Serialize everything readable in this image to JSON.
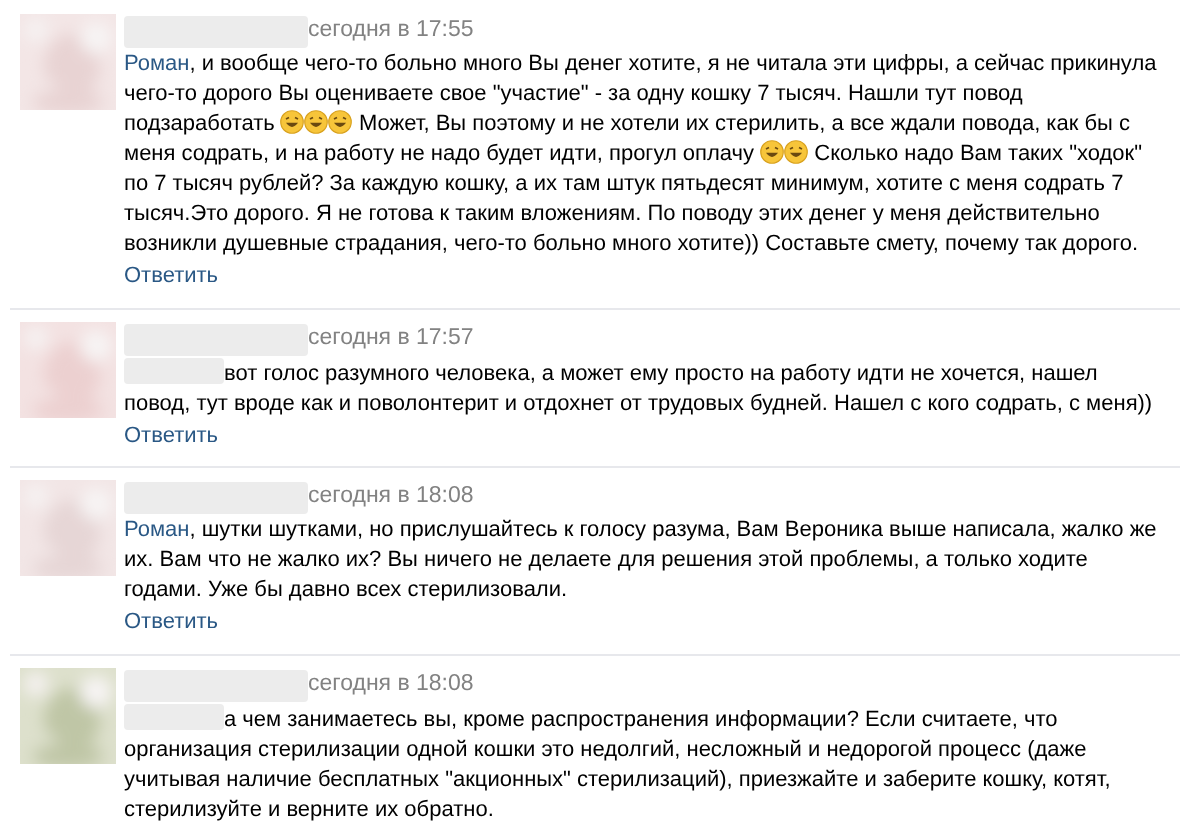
{
  "comments": [
    {
      "time": "сегодня в 17:55",
      "segments": [
        {
          "kind": "mention",
          "text": "Роман"
        },
        {
          "kind": "text",
          "text": ", и вообще чего-то больно много Вы денег хотите, я не читала эти цифры, а сейчас прикинула чего-то дорого Вы оцениваете свое \"участие\" - за одну кошку 7 тысяч. Нашли тут повод подзаработать "
        },
        {
          "kind": "emoji"
        },
        {
          "kind": "emoji"
        },
        {
          "kind": "emoji"
        },
        {
          "kind": "text",
          "text": " Может, Вы поэтому и не хотели их стерилить, а все ждали повода, как бы с меня содрать, и на работу не надо будет идти, прогул оплачу "
        },
        {
          "kind": "emoji"
        },
        {
          "kind": "emoji"
        },
        {
          "kind": "text",
          "text": " Сколько надо Вам таких \"ходок\" по 7 тысяч рублей? За каждую кошку, а их там штук пятьдесят минимум, хотите с меня содрать 7 тысяч.Это дорого. Я не готова к таким вложениям. По поводу этих денег у меня действительно возникли душевные страдания, чего-то больно много хотите)) Составьте смету, почему так дорого."
        }
      ],
      "reply": "Ответить"
    },
    {
      "time": "сегодня в 17:57",
      "segments": [
        {
          "kind": "redacted"
        },
        {
          "kind": "text",
          "text": "вот голос разумного человека, а может ему просто на работу идти не хочется, нашел повод, тут вроде как и поволонтерит и отдохнет от трудовых будней. Нашел с кого содрать, с меня))"
        }
      ],
      "reply": "Ответить"
    },
    {
      "time": "сегодня в 18:08",
      "segments": [
        {
          "kind": "mention",
          "text": "Роман"
        },
        {
          "kind": "text",
          "text": ", шутки шутками, но прислушайтесь к голосу разума, Вам Вероника выше написала, жалко же их. Вам что не жалко их? Вы ничего не делаете для решения этой проблемы, а только ходите годами. Уже бы давно всех стерилизовали."
        }
      ],
      "reply": "Ответить"
    },
    {
      "time": "сегодня в 18:08",
      "segments": [
        {
          "kind": "redacted"
        },
        {
          "kind": "text",
          "text": "а чем занимаетесь вы, кроме распространения информации? Если считаете, что организация стерилизации одной кошки это недолгий, несложный и недорогой процесс (даже учитывая наличие бесплатных \"акционных\" стерилизаций), приезжайте и заберите кошку, котят, стерилизуйте и верните их обратно."
        }
      ]
    }
  ]
}
